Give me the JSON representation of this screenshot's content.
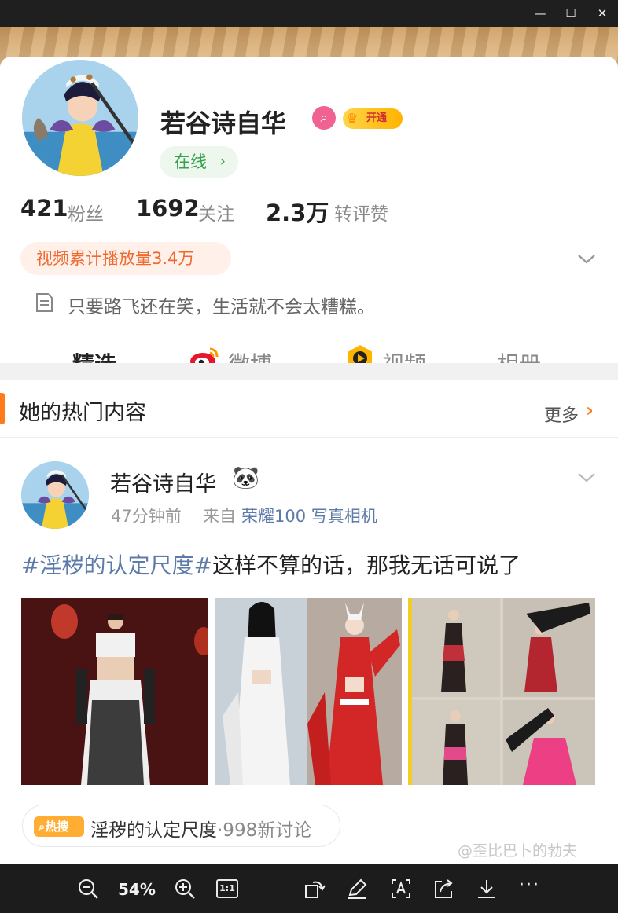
{
  "window": {
    "minimize_glyph": "—",
    "maximize_glyph": "☐",
    "close_glyph": "✕"
  },
  "profile": {
    "username": "若谷诗自华",
    "vip_label": "开通",
    "online_label": "在线",
    "stats": [
      {
        "value": "421",
        "label": "粉丝"
      },
      {
        "value": "1692",
        "label": "关注"
      },
      {
        "value": "2.3万",
        "label": "转评赞"
      }
    ],
    "video_plays": "视频累计播放量3.4万",
    "bio": "只要路飞还在笑，生活就不会太糟糕。"
  },
  "tabs": [
    {
      "label": "精选",
      "active": true
    },
    {
      "label": "微博",
      "icon": "weibo-icon"
    },
    {
      "label": "视频",
      "icon": "video-play-icon"
    },
    {
      "label": "相册"
    }
  ],
  "hot_section": {
    "title": "她的热门内容",
    "more_label": "更多"
  },
  "post": {
    "author": "若谷诗自华",
    "author_emoji": "🐼",
    "time": "47分钟前",
    "from_label": "来自",
    "device": "荣耀100 写真相机",
    "hashtag": "#淫秽的认定尺度#",
    "text": "这样不算的话，那我无话可说了"
  },
  "topic": {
    "badge": "热搜",
    "name": "淫秽的认定尺度",
    "count": "·998新讨论"
  },
  "watermark": "@歪比巴卜的勃夫",
  "toolbar": {
    "zoom": "54%",
    "ratio_label": "1:1",
    "more_label": "···"
  },
  "colors": {
    "accent": "#ff7a1a",
    "link": "#5d7ba8",
    "online_green": "#35a24b",
    "toolbar_bg": "#1c1c1c"
  }
}
